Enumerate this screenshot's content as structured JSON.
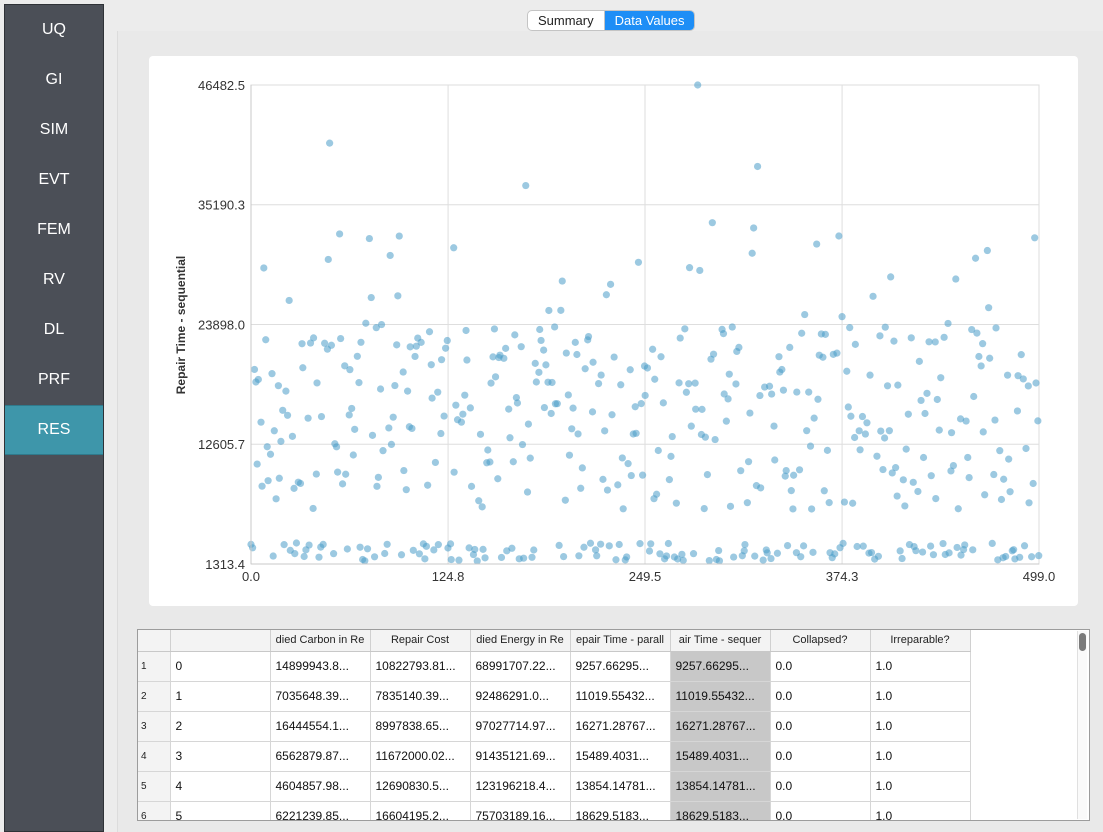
{
  "sidebar": {
    "items": [
      {
        "label": "UQ"
      },
      {
        "label": "GI"
      },
      {
        "label": "SIM"
      },
      {
        "label": "EVT"
      },
      {
        "label": "FEM"
      },
      {
        "label": "RV"
      },
      {
        "label": "DL"
      },
      {
        "label": "PRF"
      },
      {
        "label": "RES"
      }
    ],
    "active": 8,
    "active_color": "#3e96aa"
  },
  "tabs": [
    {
      "label": "Summary"
    },
    {
      "label": "Data Values"
    }
  ],
  "active_tab": 1,
  "chart_data": {
    "type": "scatter",
    "ylabel": "Repair Time - sequential",
    "xlabel": "",
    "xlim": [
      0.0,
      499.0
    ],
    "ylim": [
      1313.4,
      46482.5
    ],
    "x_ticks": [
      "0.0",
      "124.8",
      "249.5",
      "374.3",
      "499.0"
    ],
    "y_ticks": [
      "1313.4",
      "12605.7",
      "23898.0",
      "35190.3",
      "46482.5"
    ],
    "grid": true,
    "point_color": "#4b9cc9",
    "n_points": 500
  },
  "table": {
    "columns": [
      "",
      "died Carbon in Re",
      "Repair Cost",
      "died Energy in Re",
      "epair Time - parall",
      "air Time - sequer",
      "Collapsed?",
      "Irreparable?"
    ],
    "rows": [
      {
        "n": "1",
        "cells": [
          "0",
          "14899943.8...",
          "10822793.81...",
          "68991707.22...",
          "9257.66295...",
          "9257.66295...",
          "0.0",
          "1.0"
        ]
      },
      {
        "n": "2",
        "cells": [
          "1",
          "7035648.39...",
          "7835140.39...",
          "92486291.0...",
          "11019.55432...",
          "11019.55432...",
          "0.0",
          "1.0"
        ]
      },
      {
        "n": "3",
        "cells": [
          "2",
          "16444554.1...",
          "8997838.65...",
          "97027714.97...",
          "16271.28767...",
          "16271.28767...",
          "0.0",
          "1.0"
        ]
      },
      {
        "n": "4",
        "cells": [
          "3",
          "6562879.87...",
          "11672000.02...",
          "91435121.69...",
          "15489.4031...",
          "15489.4031...",
          "0.0",
          "1.0"
        ]
      },
      {
        "n": "5",
        "cells": [
          "4",
          "4604857.98...",
          "12690830.5...",
          "123196218.4...",
          "13854.14781...",
          "13854.14781...",
          "0.0",
          "1.0"
        ]
      },
      {
        "n": "6",
        "cells": [
          "5",
          "6221239.85...",
          "16604195.2...",
          "75703189.16...",
          "18629.5183...",
          "18629.5183...",
          "0.0",
          "1.0"
        ]
      }
    ],
    "selected_column": 5
  }
}
